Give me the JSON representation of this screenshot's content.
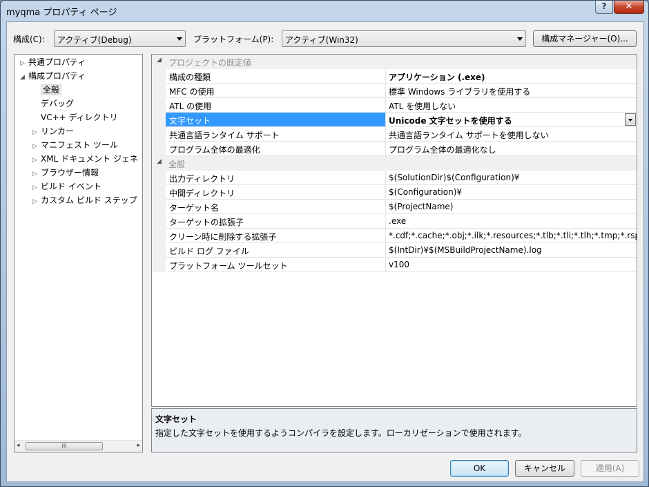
{
  "window": {
    "title": "myqma プロパティ ページ",
    "help_label": "?",
    "close_label": "✕"
  },
  "toolbar": {
    "config_label": "構成(C):",
    "config_value": "アクティブ(Debug)",
    "platform_label": "プラットフォーム(P):",
    "platform_value": "アクティブ(Win32)",
    "config_manager_label": "構成マネージャー(O)..."
  },
  "tree": {
    "items": [
      {
        "label": "共通プロパティ",
        "arrow": "▷"
      },
      {
        "label": "構成プロパティ",
        "arrow": "◢"
      },
      {
        "label": "全般",
        "arrow": ""
      },
      {
        "label": "デバッグ",
        "arrow": ""
      },
      {
        "label": "VC++ ディレクトリ",
        "arrow": ""
      },
      {
        "label": "リンカー",
        "arrow": "▷"
      },
      {
        "label": "マニフェスト ツール",
        "arrow": "▷"
      },
      {
        "label": "XML ドキュメント ジェネ",
        "arrow": "▷"
      },
      {
        "label": "ブラウザー情報",
        "arrow": "▷"
      },
      {
        "label": "ビルド イベント",
        "arrow": "▷"
      },
      {
        "label": "カスタム ビルド ステップ",
        "arrow": "▷"
      }
    ],
    "selected": "全般",
    "scroll_left": "◂",
    "scroll_right": "▸",
    "scroll_thumb": "III"
  },
  "grid": {
    "categories": [
      {
        "label": "プロジェクトの既定値",
        "toggle": "◢"
      },
      {
        "label": "全般",
        "toggle": "◢"
      }
    ],
    "rows": [
      {
        "name": "構成の種類",
        "value": "アプリケーション (.exe)"
      },
      {
        "name": "MFC の使用",
        "value": "標準 Windows ライブラリを使用する"
      },
      {
        "name": "ATL の使用",
        "value": "ATL を使用しない"
      },
      {
        "name": "文字セット",
        "value": "Unicode 文字セットを使用する"
      },
      {
        "name": "共通言語ランタイム サポート",
        "value": "共通言語ランタイム サポートを使用しない"
      },
      {
        "name": "プログラム全体の最適化",
        "value": "プログラム全体の最適化なし"
      },
      {
        "name": "出力ディレクトリ",
        "value": "$(SolutionDir)$(Configuration)¥"
      },
      {
        "name": "中間ディレクトリ",
        "value": "$(Configuration)¥"
      },
      {
        "name": "ターゲット名",
        "value": "$(ProjectName)"
      },
      {
        "name": "ターゲットの拡張子",
        "value": ".exe"
      },
      {
        "name": "クリーン時に削除する拡張子",
        "value": "*.cdf;*.cache;*.obj;*.ilk;*.resources;*.tlb;*.tli;*.tlh;*.tmp;*.rsp;*.pgc;*.pgd;*.meta"
      },
      {
        "name": "ビルド ログ ファイル",
        "value": "$(IntDir)¥$(MSBuildProjectName).log"
      },
      {
        "name": "プラットフォーム ツールセット",
        "value": "v100"
      }
    ]
  },
  "description": {
    "title": "文字セット",
    "body": "指定した文字セットを使用するようコンパイラを設定します。ローカリゼーションで使用されます。"
  },
  "buttons": {
    "ok": "OK",
    "cancel": "キャンセル",
    "apply": "適用(A)"
  },
  "colors": {
    "selection": "#3399ff",
    "category_text": "#8e8e8e"
  }
}
